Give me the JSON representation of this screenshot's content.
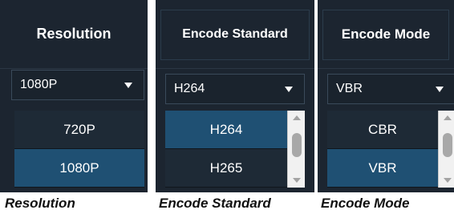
{
  "panels": [
    {
      "header": "Resolution",
      "selected": "1080P",
      "options": [
        "720P",
        "1080P"
      ],
      "highlighted_option": "1080P",
      "caption": "Resolution"
    },
    {
      "header": "Encode Standard",
      "selected": "H264",
      "options": [
        "H264",
        "H265"
      ],
      "highlighted_option": "H264",
      "caption": "Encode Standard"
    },
    {
      "header": "Encode Mode",
      "selected": "VBR",
      "options": [
        "CBR",
        "VBR"
      ],
      "highlighted_option": "VBR",
      "caption": "Encode Mode"
    }
  ],
  "colors": {
    "panel_bg": "#1c2530",
    "highlight": "#1f5073",
    "option_bg": "#1e2a36",
    "text": "#ffffff"
  },
  "icons": {
    "dropdown": "chevron-down-icon",
    "scroll_up": "scroll-up-arrow-icon",
    "scroll_down": "scroll-down-arrow-icon"
  }
}
